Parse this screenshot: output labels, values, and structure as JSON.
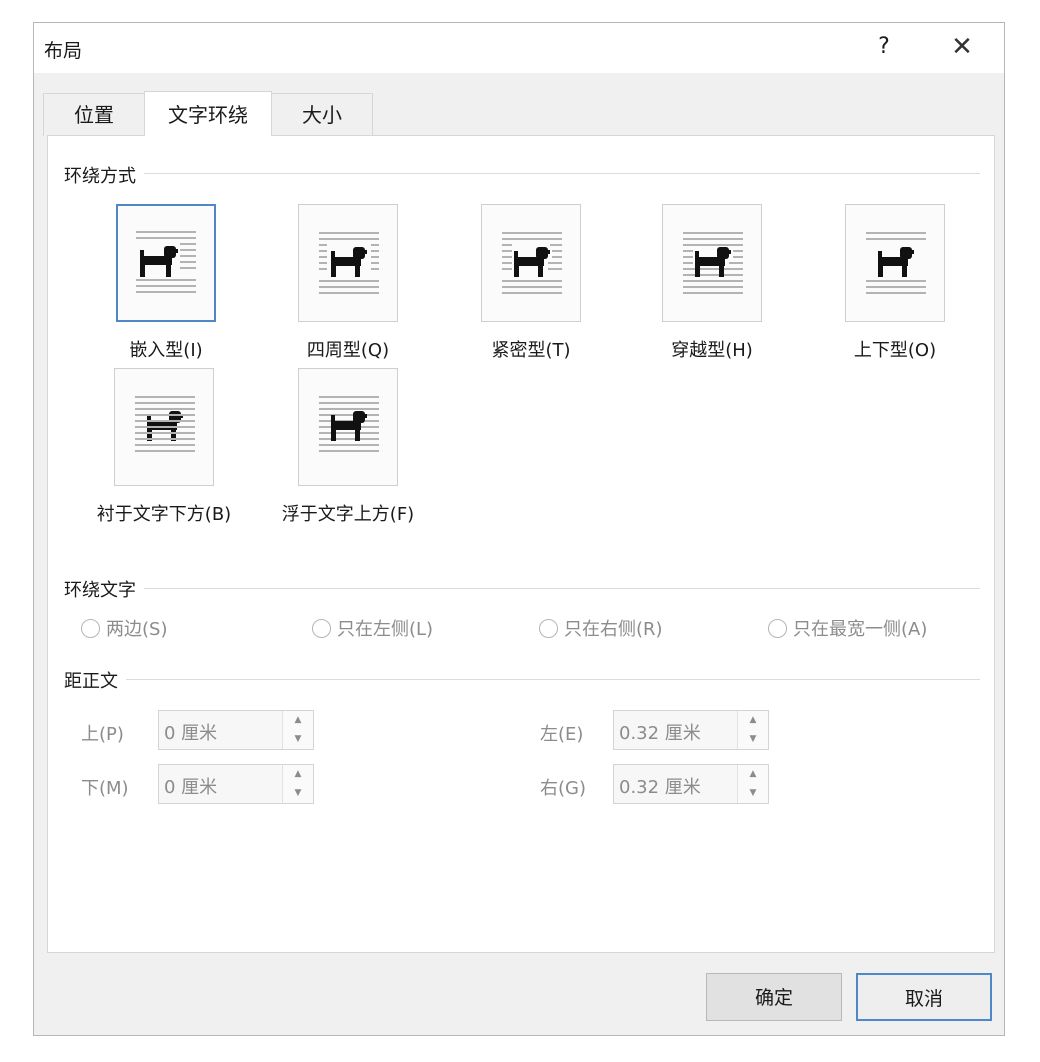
{
  "dialog": {
    "title": "布局",
    "help": "?",
    "close": "✕"
  },
  "tabs": [
    {
      "label": "位置"
    },
    {
      "label": "文字环绕"
    },
    {
      "label": "大小"
    }
  ],
  "wrap_style": {
    "title": "环绕方式",
    "options": [
      {
        "label": "嵌入型(I)",
        "selected": true
      },
      {
        "label": "四周型(Q)"
      },
      {
        "label": "紧密型(T)"
      },
      {
        "label": "穿越型(H)"
      },
      {
        "label": "上下型(O)"
      },
      {
        "label": "衬于文字下方(B)"
      },
      {
        "label": "浮于文字上方(F)"
      }
    ]
  },
  "wrap_text": {
    "title": "环绕文字",
    "options": [
      {
        "label": "两边(S)"
      },
      {
        "label": "只在左侧(L)"
      },
      {
        "label": "只在右侧(R)"
      },
      {
        "label": "只在最宽一侧(A)"
      }
    ]
  },
  "distance": {
    "title": "距正文",
    "top": {
      "label": "上(P)",
      "value": "0 厘米"
    },
    "bottom": {
      "label": "下(M)",
      "value": "0 厘米"
    },
    "left": {
      "label": "左(E)",
      "value": "0.32 厘米"
    },
    "right": {
      "label": "右(G)",
      "value": "0.32 厘米"
    }
  },
  "buttons": {
    "ok": "确定",
    "cancel": "取消"
  },
  "colors": {
    "accent": "#4f88c9",
    "disabled_text": "#8c8c8c",
    "dialog_bg": "#f0f0f0"
  }
}
